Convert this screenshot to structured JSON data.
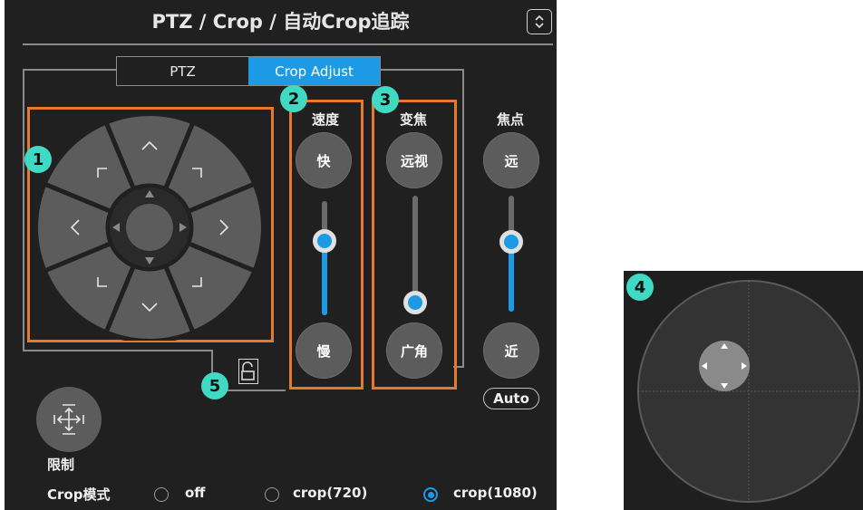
{
  "panel": {
    "title": "PTZ / Crop / 自动Crop追踪",
    "tabs": [
      {
        "label": "PTZ",
        "active": false
      },
      {
        "label": "Crop Adjust",
        "active": true
      }
    ],
    "badges": [
      "1",
      "2",
      "3",
      "4",
      "5"
    ],
    "speed": {
      "label": "速度",
      "fast": "快",
      "slow": "慢",
      "level": 0.65
    },
    "zoom": {
      "label": "变焦",
      "tele": "远视",
      "wide": "广角",
      "level": 0.08
    },
    "focus": {
      "label": "焦点",
      "far": "远",
      "near": "近",
      "level": 0.6,
      "auto": "Auto"
    },
    "limit_label": "限制",
    "crop_mode": {
      "label": "Crop模式",
      "options": [
        {
          "label": "off",
          "selected": false
        },
        {
          "label": "crop(720)",
          "selected": false
        },
        {
          "label": "crop(1080)",
          "selected": true
        }
      ]
    }
  },
  "colors": {
    "accent": "#1d9ae6",
    "highlight": "#e8782b",
    "badge": "#3fd9c4",
    "panel_bg": "#202020"
  },
  "icons": [
    "chevron-up-down-icon",
    "move-arrows-icon",
    "unlock-icon",
    "dpad-arrow-icons"
  ]
}
